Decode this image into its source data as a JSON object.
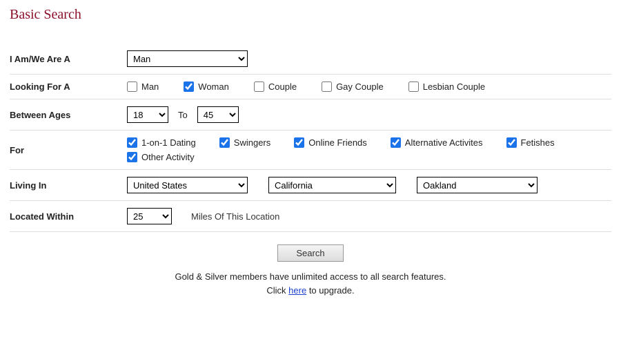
{
  "title": "Basic Search",
  "rows": {
    "iam": {
      "label": "I Am/We Are A",
      "value": "Man"
    },
    "looking_for": {
      "label": "Looking For A",
      "options": [
        {
          "label": "Man",
          "checked": false
        },
        {
          "label": "Woman",
          "checked": true
        },
        {
          "label": "Couple",
          "checked": false
        },
        {
          "label": "Gay Couple",
          "checked": false
        },
        {
          "label": "Lesbian Couple",
          "checked": false
        }
      ]
    },
    "ages": {
      "label": "Between Ages",
      "from": "18",
      "to_text": "To",
      "to": "45"
    },
    "for": {
      "label": "For",
      "options": [
        {
          "label": "1-on-1 Dating",
          "checked": true
        },
        {
          "label": "Swingers",
          "checked": true
        },
        {
          "label": "Online Friends",
          "checked": true
        },
        {
          "label": "Alternative Activites",
          "checked": true
        },
        {
          "label": "Fetishes",
          "checked": true
        },
        {
          "label": "Other Activity",
          "checked": true
        }
      ]
    },
    "living_in": {
      "label": "Living In",
      "country": "United States",
      "region": "California",
      "city": "Oakland"
    },
    "located_within": {
      "label": "Located Within",
      "distance": "25",
      "suffix": "Miles Of This Location"
    }
  },
  "search_button": "Search",
  "footer": {
    "line1": "Gold & Silver members have unlimited access to all search features.",
    "line2_prefix": "Click ",
    "line2_link": "here",
    "line2_suffix": " to upgrade."
  }
}
